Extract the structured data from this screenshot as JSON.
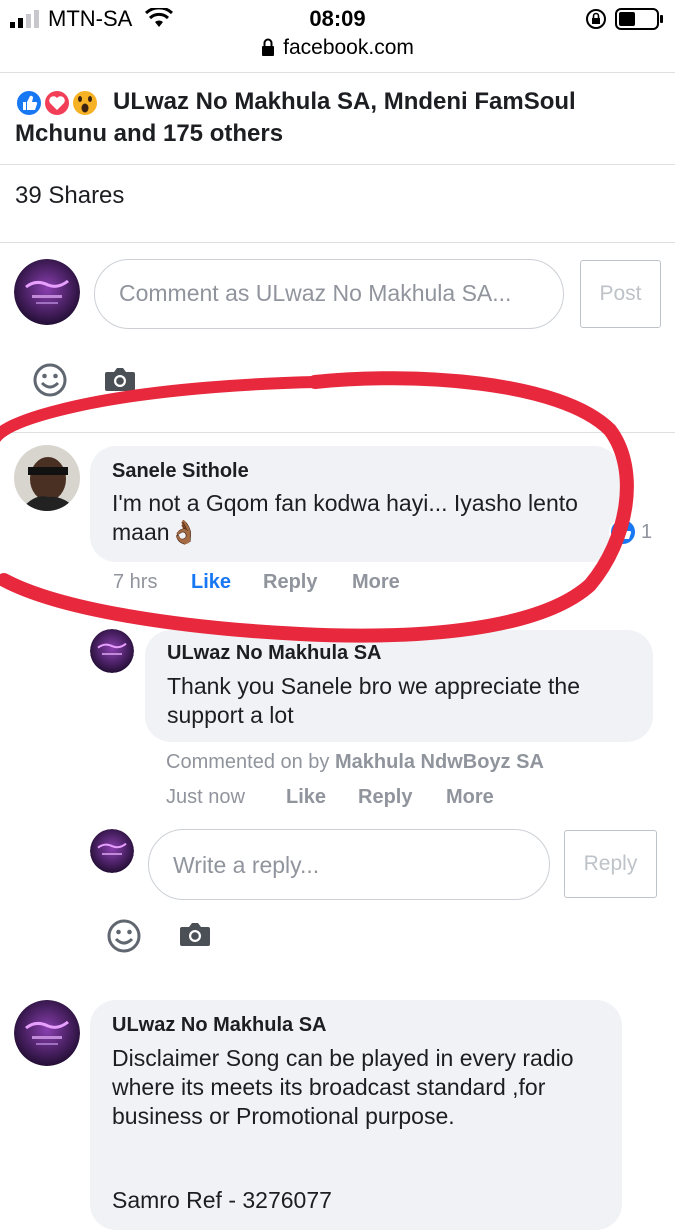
{
  "status": {
    "carrier": "MTN-SA",
    "time": "08:09",
    "url": "facebook.com"
  },
  "post": {
    "reactions": [
      "like-icon",
      "love-icon",
      "wow-icon"
    ],
    "likers": "ULwaz No Makhula SA, Mndeni FamSoul Mchunu and 175 others",
    "shares": "39 Shares"
  },
  "composer": {
    "placeholder": "Comment as ULwaz No Makhula SA...",
    "post_label": "Post"
  },
  "comments": [
    {
      "author": "Sanele Sithole",
      "text": "I'm not a Gqom fan kodwa hayi... Iyasho lento maan👌🏾",
      "time": "7 hrs",
      "like": "Like",
      "reply": "Reply",
      "more": "More",
      "reaction_count": "1"
    },
    {
      "author": "ULwaz No Makhula SA",
      "text": "Thank you Sanele bro we appreciate the support a lot",
      "commented_on_by_label": "Commented on by",
      "commented_on_by_name": "Makhula NdwBoyz SA",
      "time": "Just now",
      "like": "Like",
      "reply": "Reply",
      "more": "More"
    },
    {
      "author": "ULwaz No Makhula SA",
      "text": "Disclaimer Song can be played in every radio where its meets its broadcast standard ,for business or Promotional purpose.",
      "text2": "Samro Ref - 3276077"
    }
  ],
  "reply_box": {
    "placeholder": "Write a reply...",
    "reply_label": "Reply"
  },
  "colors": {
    "accent": "#1877f2",
    "annotation": "#e8283d",
    "bubble": "#f0f2f5"
  }
}
